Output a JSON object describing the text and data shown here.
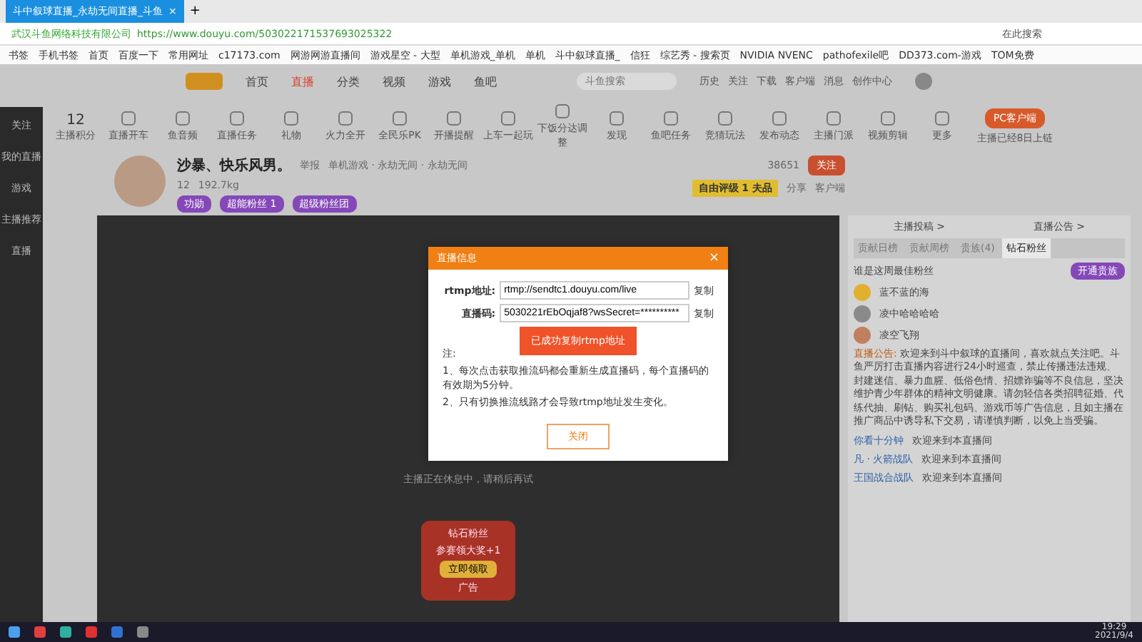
{
  "browser": {
    "tab": {
      "title": "斗中叙球直播_永劫无间直播_斗鱼",
      "close": "×",
      "new_tab": "+"
    },
    "address": {
      "site": "武汉斗鱼网络科技有限公司",
      "url": "https://www.douyu.com/503022171537693025322"
    },
    "search": {
      "placeholder": "在此搜索"
    },
    "bookmarks": [
      "书签",
      "手机书签",
      "首页",
      "百度一下",
      "常用网址",
      "c17173.com",
      "网游网游直播间",
      "游戏星空 - 大型",
      "单机游戏_单机",
      "单机",
      "斗中叙球直播_",
      "信狂",
      "综艺秀 - 搜索页",
      "NVIDIA NVENC",
      "pathofexile吧",
      "DD373.com-游戏",
      "TOM免费"
    ]
  },
  "site": {
    "nav": [
      {
        "label": "首页",
        "selected": false
      },
      {
        "label": "直播",
        "selected": true
      },
      {
        "label": "分类",
        "selected": false
      },
      {
        "label": "视频",
        "selected": false
      },
      {
        "label": "游戏",
        "selected": false
      },
      {
        "label": "鱼吧",
        "selected": false
      }
    ],
    "search": {
      "placeholder": "斗鱼搜索"
    },
    "header_icons": [
      "历史",
      "关注",
      "下载",
      "客户端",
      "消息",
      "创作中心"
    ],
    "sidebar": [
      "关注",
      "我的直播",
      "游戏",
      "主播推荐",
      "直播"
    ],
    "score": {
      "value": "12",
      "label": "主播积分"
    },
    "tools": [
      "直播开车",
      "鱼音频",
      "直播任务",
      "礼物",
      "火力全开",
      "全民乐PK",
      "开播提醒",
      "上车一起玩",
      "下饭分达调整",
      "发现",
      "鱼吧任务",
      "竞猜玩法",
      "发布动态",
      "主播门派",
      "视频剪辑",
      "更多"
    ],
    "pc_client": {
      "label": "PC客户端",
      "note": "主播已经8日上链"
    }
  },
  "streamer": {
    "name": "沙暴、快乐风男。",
    "report": "举报",
    "category": "单机游戏 · 永劫无间 · 永劫无间",
    "level": "12",
    "weight": "192.7kg",
    "badges": [
      "功勋",
      "超能粉丝 1",
      "超级粉丝团"
    ],
    "followers": "38651",
    "follow": "关注",
    "rank": "自由评级 1 夫品",
    "share": "分享",
    "client": "客户端"
  },
  "video": {
    "message": "主播正在休息中，请稍后再试",
    "ad": "广告",
    "promo": "参赛领大奖+1",
    "promo_button": "立即领取",
    "gift_label": "钻石粉丝"
  },
  "dialog": {
    "title": "直播信息",
    "close": "×",
    "fields": [
      {
        "label": "rtmp地址:",
        "value": "rtmp://sendtc1.douyu.com/live",
        "copy": "复制"
      },
      {
        "label": "直播码:",
        "value": "5030221rEbOqjaf8?wsSecret=**********",
        "copy": "复制"
      }
    ],
    "toast": "已成功复制rtmp地址",
    "notes": [
      "注:",
      "1、每次点击获取推流码都会重新生成直播码，每个直播码的有效期为5分钟。",
      "2、只有切换推流线路才会导致rtmp地址发生变化。"
    ],
    "button": "关闭"
  },
  "panel": {
    "links": [
      "主播投稿 >",
      "直播公告 >"
    ],
    "tabs": [
      {
        "label": "贡献日榜",
        "selected": false
      },
      {
        "label": "贡献周榜",
        "selected": false
      },
      {
        "label": "贵族(4)",
        "selected": false
      },
      {
        "label": "钻石粉丝",
        "selected": true
      }
    ],
    "rank_title": "谁是这周最佳粉丝",
    "rank_button": "开通贵族",
    "ranks": [
      {
        "name": "蓝不蓝的海",
        "color": "#e0b030"
      },
      {
        "name": "凌中哈哈哈哈",
        "color": "#8a8a8a"
      },
      {
        "name": "凌空飞翔",
        "color": "#c08060"
      }
    ],
    "notice_label": "直播公告:",
    "notice": "欢迎来到斗中叙球的直播间，喜欢就点关注吧。斗鱼严厉打击直播内容进行24小时巡查，禁止传播违法违规、封建迷信、暴力血腥、低俗色情、招嫖诈骗等不良信息，坚决维护青少年群体的精神文明健康。请勿轻信各类招聘征婚、代练代抽、刷钻、购买礼包码、游戏币等广告信息，且如主播在推广商品中诱导私下交易，请谨慎判断，以免上当受骗。",
    "chats": [
      {
        "name": "你看十分钟",
        "text": "欢迎来到本直播间"
      },
      {
        "name": "凡 · 火箭战队",
        "text": "欢迎来到本直播间"
      },
      {
        "name": "王国战合战队",
        "text": "欢迎来到本直播间"
      }
    ]
  },
  "taskbar": {
    "time": "19:29",
    "date": "2021/9/4"
  }
}
